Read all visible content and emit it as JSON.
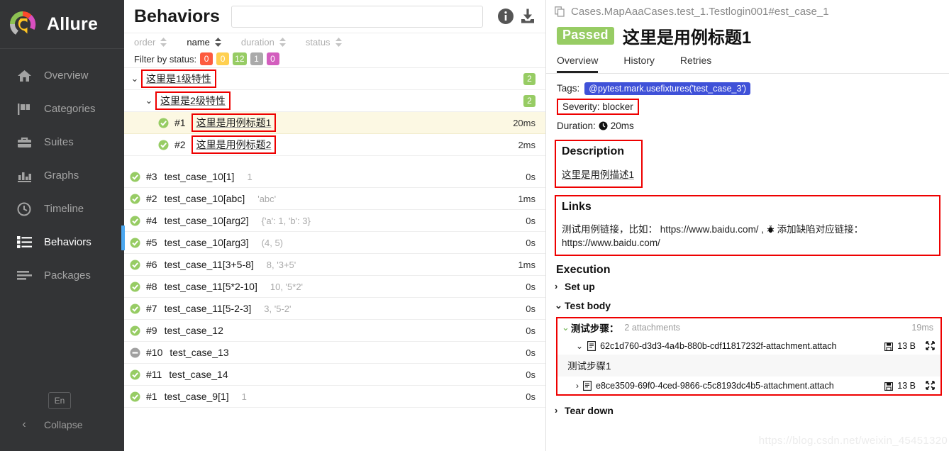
{
  "brand": {
    "name": "Allure",
    "logo_icon": "allure-logo-icon"
  },
  "sidebar": {
    "items": [
      {
        "label": "Overview",
        "icon": "home-icon",
        "active": false
      },
      {
        "label": "Categories",
        "icon": "flag-icon",
        "active": false
      },
      {
        "label": "Suites",
        "icon": "briefcase-icon",
        "active": false
      },
      {
        "label": "Graphs",
        "icon": "bar-chart-icon",
        "active": false
      },
      {
        "label": "Timeline",
        "icon": "clock-icon",
        "active": false
      },
      {
        "label": "Behaviors",
        "icon": "list-icon",
        "active": true
      },
      {
        "label": "Packages",
        "icon": "layers-icon",
        "active": false
      }
    ],
    "language_button": "En",
    "collapse_label": "Collapse",
    "collapse_icon": "chevron-left-icon"
  },
  "mid": {
    "title": "Behaviors",
    "search_value": "",
    "search_placeholder": "",
    "info_icon": "info-icon",
    "download_icon": "download-icon",
    "sort_columns": [
      {
        "label": "order",
        "active": false
      },
      {
        "label": "name",
        "active": true
      },
      {
        "label": "duration",
        "active": false
      },
      {
        "label": "status",
        "active": false
      }
    ],
    "filter_label": "Filter by status:",
    "filter_badges": [
      {
        "count": "0",
        "color": "#fd5a3e",
        "status": "failed"
      },
      {
        "count": "0",
        "color": "#ffd050",
        "status": "broken"
      },
      {
        "count": "12",
        "color": "#97cc64",
        "status": "passed"
      },
      {
        "count": "1",
        "color": "#aaaaaa",
        "status": "skipped"
      },
      {
        "count": "0",
        "color": "#d35ebe",
        "status": "unknown"
      }
    ],
    "tree": [
      {
        "type": "group",
        "indent": 0,
        "chevron": "⌄",
        "label": "这里是1级特性",
        "count": "2",
        "boxed": true
      },
      {
        "type": "group",
        "indent": 1,
        "chevron": "⌄",
        "label": "这里是2级特性",
        "count": "2",
        "boxed": true
      }
    ],
    "nested_cases": [
      {
        "status": "passed",
        "num": "#1",
        "name": "这里是用例标题1",
        "params": "",
        "duration": "20ms",
        "selected": true,
        "boxed": true
      },
      {
        "status": "passed",
        "num": "#2",
        "name": "这里是用例标题2",
        "params": "",
        "duration": "2ms",
        "selected": false,
        "boxed": true
      }
    ],
    "cases": [
      {
        "status": "passed",
        "num": "#3",
        "name": "test_case_10[1]",
        "params": "1",
        "duration": "0s"
      },
      {
        "status": "passed",
        "num": "#2",
        "name": "test_case_10[abc]",
        "params": "'abc'",
        "duration": "1ms"
      },
      {
        "status": "passed",
        "num": "#4",
        "name": "test_case_10[arg2]",
        "params": "{'a': 1, 'b': 3}",
        "duration": "0s"
      },
      {
        "status": "passed",
        "num": "#5",
        "name": "test_case_10[arg3]",
        "params": "(4, 5)",
        "duration": "0s"
      },
      {
        "status": "passed",
        "num": "#6",
        "name": "test_case_11[3+5-8]",
        "params": "8, '3+5'",
        "duration": "1ms"
      },
      {
        "status": "passed",
        "num": "#8",
        "name": "test_case_11[5*2-10]",
        "params": "10, '5*2'",
        "duration": "0s"
      },
      {
        "status": "passed",
        "num": "#7",
        "name": "test_case_11[5-2-3]",
        "params": "3, '5-2'",
        "duration": "0s"
      },
      {
        "status": "passed",
        "num": "#9",
        "name": "test_case_12",
        "params": "",
        "duration": "0s"
      },
      {
        "status": "skipped",
        "num": "#10",
        "name": "test_case_13",
        "params": "",
        "duration": "0s"
      },
      {
        "status": "passed",
        "num": "#11",
        "name": "test_case_14",
        "params": "",
        "duration": "0s"
      },
      {
        "status": "passed",
        "num": "#1",
        "name": "test_case_9[1]",
        "params": "1",
        "duration": "0s"
      }
    ]
  },
  "detail": {
    "breadcrumb": "Cases.MapAaaCases.test_1.Testlogin001#est_case_1",
    "breadcrumb_icon": "copy-icon",
    "status_label": "Passed",
    "status_color": "#97cc64",
    "case_title": "这里是用例标题1",
    "tabs": [
      {
        "label": "Overview",
        "active": true
      },
      {
        "label": "History",
        "active": false
      },
      {
        "label": "Retries",
        "active": false
      }
    ],
    "tags_label": "Tags:",
    "tags": [
      "@pytest.mark.usefixtures('test_case_3')"
    ],
    "severity_text": "Severity: blocker",
    "duration_label": "Duration:",
    "duration_value": "20ms",
    "duration_icon": "clock-icon",
    "description_heading": "Description",
    "description_body": "这里是用例描述1",
    "links_heading": "Links",
    "links_body_pre": "测试用例链接，比如： https://www.baidu.com/ ,",
    "links_bug_icon": "bug-icon",
    "links_body_post": "添加缺陷对应链接： https://www.baidu.com/",
    "execution_heading": "Execution",
    "setup_label": "Set up",
    "setup_chevron": "›",
    "testbody_label": "Test body",
    "testbody_chevron": "⌄",
    "teardown_label": "Tear down",
    "teardown_chevron": "›",
    "step": {
      "chevron": "⌄",
      "title": "测试步骤：",
      "attachments_note": "2 attachments",
      "duration": "19ms",
      "attachments": [
        {
          "chevron": "⌄",
          "expanded": true,
          "name": "62c1d760-d3d3-4a4b-880b-cdf11817232f-attachment.attach",
          "size": "13 B",
          "save_icon": "floppy-icon",
          "expand_icon": "fullscreen-icon",
          "content": "测试步骤1"
        },
        {
          "chevron": "›",
          "expanded": false,
          "name": "e8ce3509-69f0-4ced-9866-c5c8193dc4b5-attachment.attach",
          "size": "13 B",
          "save_icon": "floppy-icon",
          "expand_icon": "fullscreen-icon",
          "content": ""
        }
      ]
    },
    "watermark": "https://blog.csdn.net/weixin_45451320"
  }
}
